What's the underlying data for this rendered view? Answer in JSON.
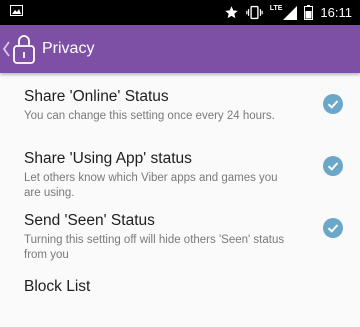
{
  "status_bar": {
    "time": "16:11",
    "network_label": "LTE",
    "icons": [
      "gallery-icon",
      "star-icon",
      "vibrate-icon",
      "signal-icon",
      "battery-icon"
    ]
  },
  "toolbar": {
    "title": "Privacy",
    "background_color": "#7d4fa5",
    "icons": [
      "back-chevron-icon",
      "lock-icon"
    ]
  },
  "settings": {
    "items": [
      {
        "title": "Share 'Online' Status",
        "summary": "You can change this setting once every 24 hours.",
        "checked": true
      },
      {
        "title": "Share 'Using App' status",
        "summary": "Let others know which Viber apps and games you are using.",
        "checked": true
      },
      {
        "title": "Send 'Seen' Status",
        "summary": "Turning this setting off will hide others 'Seen' status from you",
        "checked": true
      }
    ],
    "check_color": "#6aa7c9"
  },
  "block_list": {
    "title": "Block List"
  }
}
